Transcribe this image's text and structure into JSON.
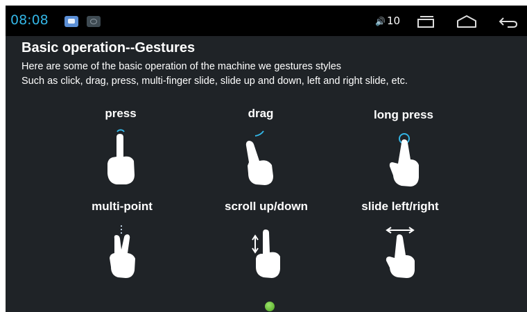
{
  "status_bar": {
    "time": "08:08",
    "volume_text": "10",
    "icons": [
      "app-notification-icon",
      "screen-mirror-icon",
      "speaker-icon",
      "recent-apps-icon",
      "home-icon",
      "back-icon"
    ],
    "accent_color": "#33b5e5"
  },
  "page": {
    "title": "Basic operation--Gestures",
    "line1": "Here are some of the basic operation of the machine we gestures styles",
    "line2": "Such as click, drag, press, multi-finger slide, slide up and down, left and right slide, etc."
  },
  "gestures": [
    {
      "label": "press",
      "icon": "press-hand-icon"
    },
    {
      "label": "drag",
      "icon": "drag-hand-icon"
    },
    {
      "label": "long press",
      "icon": "long-press-hand-icon"
    },
    {
      "label": "multi-point",
      "icon": "multi-point-hand-icon"
    },
    {
      "label": "scroll up/down",
      "icon": "scroll-hand-icon"
    },
    {
      "label": "slide left/right",
      "icon": "slide-hand-icon"
    }
  ],
  "pager": {
    "dot_color": "#6cc53a"
  }
}
